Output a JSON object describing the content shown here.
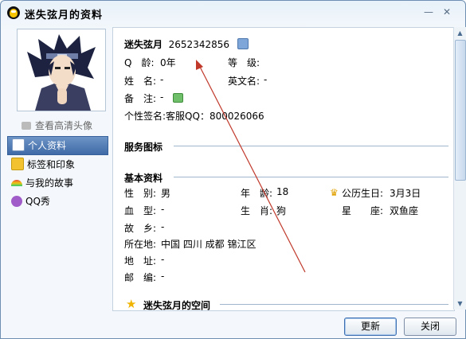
{
  "window": {
    "title": "迷失弦月的资料",
    "minimize_glyph": "—",
    "close_glyph": "✕"
  },
  "sidebar": {
    "view_hd_label": "查看高清头像",
    "items": [
      {
        "label": "个人资料",
        "icon": "profile-card-icon",
        "active": true
      },
      {
        "label": "标签和印象",
        "icon": "tag-icon",
        "active": false
      },
      {
        "label": "与我的故事",
        "icon": "rainbow-icon",
        "active": false
      },
      {
        "label": "QQ秀",
        "icon": "qq-show-icon",
        "active": false
      }
    ]
  },
  "profile": {
    "nickname": "迷失弦月",
    "qq_number": "2652342856",
    "q_age_label": "Q　龄:",
    "q_age_value": "0年",
    "level_label": "等　级:",
    "name_label": "姓　名:",
    "name_value": "-",
    "en_name_label": "英文名:",
    "en_name_value": "-",
    "remark_label": "备　注:",
    "remark_value": "-",
    "signature_label": "个性签名:",
    "signature_value": "客服QQ：800026066"
  },
  "service": {
    "title": "服务图标"
  },
  "basic": {
    "title": "基本资料",
    "gender_label": "性　别:",
    "gender_value": "男",
    "age_label": "年　龄:",
    "age_value": "18",
    "birthday_label": "公历生日:",
    "birthday_value": "3月3日",
    "blood_label": "血　型:",
    "blood_value": "-",
    "zodiac_label": "生　肖:",
    "zodiac_value": "狗",
    "constellation_label": "星　　座:",
    "constellation_value": "双鱼座",
    "hometown_label": "故　乡:",
    "hometown_value": "-",
    "location_label": "所在地:",
    "location_value": "中国 四川 成都 锦江区",
    "address_label": "地　址:",
    "address_value": "-",
    "zip_label": "邮　编:",
    "zip_value": "-"
  },
  "space": {
    "title": "迷失弦月的空间"
  },
  "buttons": {
    "refresh": "更新",
    "close": "关闭"
  },
  "colors": {
    "accent": "#3f6aa6",
    "annotation_arrow": "#c0392b",
    "section_line": "#9fb6cd"
  }
}
